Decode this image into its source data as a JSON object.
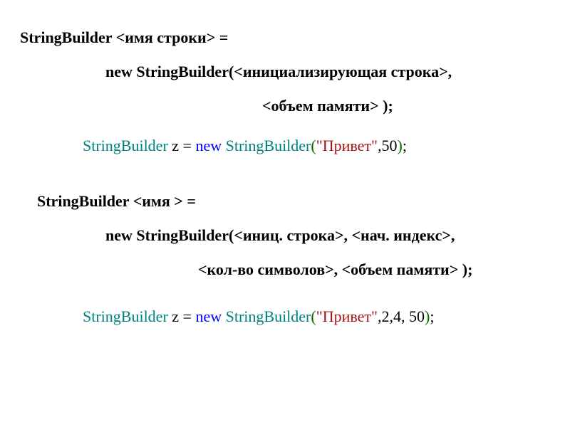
{
  "block1": {
    "line1": {
      "kw": "StringBuilder",
      "rest": "    <имя строки> ="
    },
    "line2": {
      "kw1": "new ",
      "kw2": "StringBuilder",
      "rest": "(<инициализирующая строка>,"
    },
    "line3": {
      "rest": "<объем памяти> );"
    }
  },
  "example1": {
    "type": "StringBuilder ",
    "var": "z = ",
    "newkw": "new ",
    "ctor": "StringBuilder",
    "paren1": "(",
    "str": "\"Привет\"",
    "args": ",50",
    "paren2": ")",
    "semi": ";"
  },
  "block2": {
    "line1": {
      "kw": "StringBuilder",
      "rest": "    <имя > ="
    },
    "line2": {
      "kw1": "new ",
      "kw2": "StringBuilder",
      "rest": "(<иниц. строка>, <нач. индекс>,"
    },
    "line3": {
      "rest": "<кол-во символов>, <объем памяти> );"
    }
  },
  "example2": {
    "type": "StringBuilder ",
    "var": "z = ",
    "newkw": "new ",
    "ctor": "StringBuilder",
    "paren1": "(",
    "str": "\"Привет\"",
    "args": ",2,4, 50",
    "paren2": ")",
    "semi": ";"
  }
}
